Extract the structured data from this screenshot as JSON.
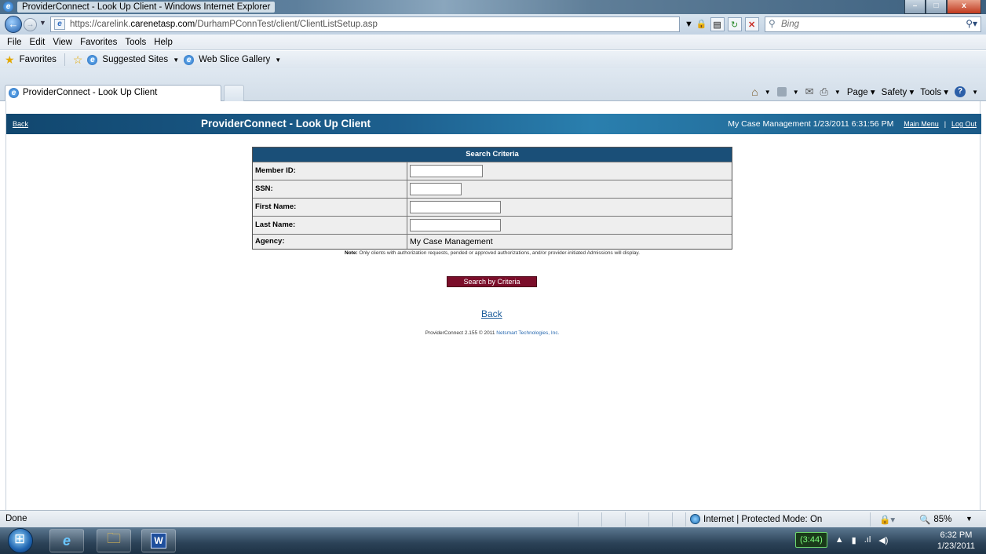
{
  "window": {
    "title": "ProviderConnect - Look Up Client - Windows Internet Explorer",
    "minimize": "–",
    "maximize": "□",
    "close": "x"
  },
  "address": {
    "url_prefix": "https://carelink.",
    "url_domain": "carenetasp.com",
    "url_path": "/DurhamPConnTest/client/ClientListSetup.asp",
    "search_placeholder": "Bing"
  },
  "menu": [
    "File",
    "Edit",
    "View",
    "Favorites",
    "Tools",
    "Help"
  ],
  "favorites": {
    "label": "Favorites",
    "items": [
      "Suggested Sites",
      "Web Slice Gallery"
    ]
  },
  "tabs": {
    "active": "ProviderConnect - Look Up Client"
  },
  "commandbar": {
    "page": "Page",
    "safety": "Safety",
    "tools": "Tools"
  },
  "banner": {
    "back": "Back",
    "title": "ProviderConnect - Look Up Client",
    "agency_datetime": "My Case Management  1/23/2011 6:31:56 PM",
    "main_menu": "Main Menu",
    "separator": "|",
    "log_out": "Log Out"
  },
  "criteria": {
    "header": "Search Criteria",
    "rows": [
      {
        "label": "Member ID:",
        "value": ""
      },
      {
        "label": "SSN:",
        "value": ""
      },
      {
        "label": "First Name:",
        "value": ""
      },
      {
        "label": "Last Name:",
        "value": ""
      },
      {
        "label": "Agency:",
        "value": "My Case Management"
      }
    ]
  },
  "note": {
    "prefix": "Note:",
    "text": "Only clients with authorization requests, pended or approved authorizations, and/or provider-initiated Admissions will display."
  },
  "search_button": "Search by Criteria",
  "back_link": "Back",
  "footer": {
    "text": "ProviderConnect 2.155 © 2011",
    "link": "Netsmart Technologies, Inc."
  },
  "status": {
    "state": "Done",
    "zone": "Internet | Protected Mode: On",
    "zoom": "85%"
  },
  "taskbar": {
    "battery": "(3:44)",
    "time": "6:32 PM",
    "date": "1/23/2011"
  }
}
